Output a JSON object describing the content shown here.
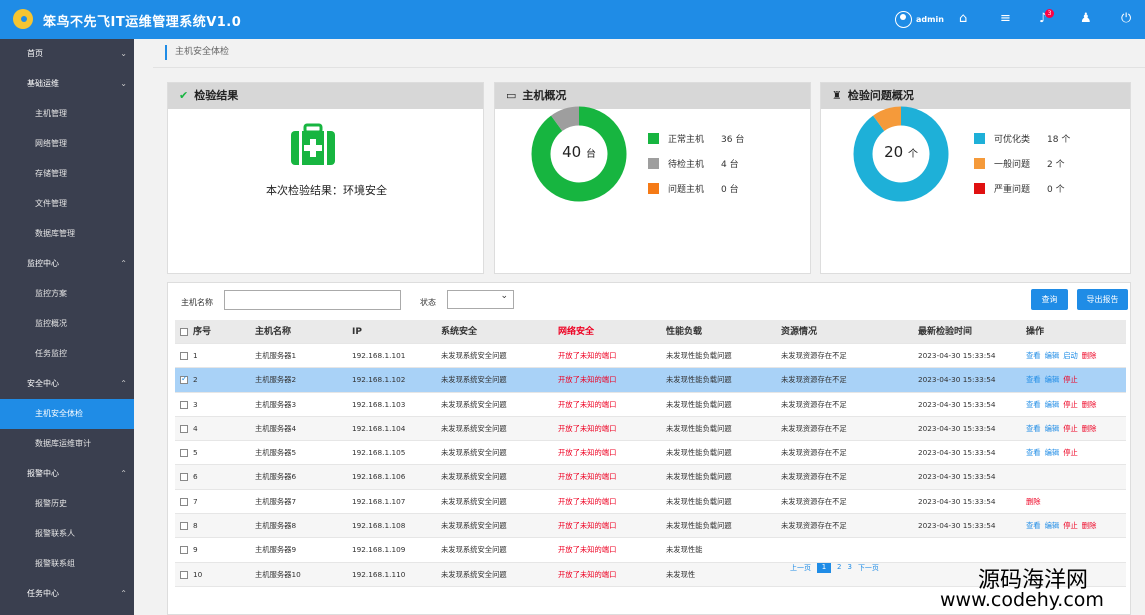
{
  "app": {
    "title": "笨鸟不先飞IT运维管理系统V1.0",
    "user": "admin",
    "notification_count": "3"
  },
  "sidebar": {
    "items": [
      {
        "label": "首页",
        "type": "group",
        "chev": "⌄"
      },
      {
        "label": "基础运维",
        "type": "group",
        "chev": "⌄"
      },
      {
        "label": "主机管理",
        "type": "child"
      },
      {
        "label": "网络管理",
        "type": "child"
      },
      {
        "label": "存储管理",
        "type": "child"
      },
      {
        "label": "文件管理",
        "type": "child"
      },
      {
        "label": "数据库管理",
        "type": "child"
      },
      {
        "label": "监控中心",
        "type": "group",
        "chev": "⌃"
      },
      {
        "label": "监控方案",
        "type": "child"
      },
      {
        "label": "监控概况",
        "type": "child"
      },
      {
        "label": "任务监控",
        "type": "child"
      },
      {
        "label": "安全中心",
        "type": "group",
        "chev": "⌃"
      },
      {
        "label": "主机安全体检",
        "type": "child",
        "active": true
      },
      {
        "label": "数据库运维审计",
        "type": "child"
      },
      {
        "label": "报警中心",
        "type": "group",
        "chev": "⌃"
      },
      {
        "label": "报警历史",
        "type": "child"
      },
      {
        "label": "报警联系人",
        "type": "child"
      },
      {
        "label": "报警联系组",
        "type": "child"
      },
      {
        "label": "任务中心",
        "type": "group",
        "chev": "⌃"
      }
    ]
  },
  "breadcrumb": "主机安全体检",
  "cards": {
    "result": {
      "title": "检验结果",
      "text": "本次检验结果：环境安全"
    },
    "hosts": {
      "title": "主机概况",
      "total": "40",
      "unit": "台",
      "legend": [
        {
          "label": "正常主机",
          "value": "36 台",
          "count": 36,
          "color": "#17b540"
        },
        {
          "label": "待检主机",
          "value": "4 台",
          "count": 4,
          "color": "#9e9e9e"
        },
        {
          "label": "问题主机",
          "value": "0 台",
          "count": 0,
          "color": "#f57a16"
        }
      ]
    },
    "issues": {
      "title": "检验问题概况",
      "total": "20",
      "unit": "个",
      "legend": [
        {
          "label": "可优化类",
          "value": "18 个",
          "count": 18,
          "color": "#1eb0d8"
        },
        {
          "label": "一般问题",
          "value": "2 个",
          "count": 2,
          "color": "#f59a3a"
        },
        {
          "label": "严重问题",
          "value": "0 个",
          "count": 0,
          "color": "#e01010"
        }
      ]
    }
  },
  "filters": {
    "host_label": "主机名称",
    "status_label": "状态",
    "query": "查询",
    "export": "导出报告"
  },
  "table": {
    "headers": [
      "序号",
      "主机名称",
      "IP",
      "系统安全",
      "网络安全",
      "性能负载",
      "资源情况",
      "最新检验时间",
      "操作"
    ],
    "rows": [
      {
        "no": "1",
        "name": "主机服务器1",
        "ip": "192.168.1.101",
        "sys": "未发现系统安全问题",
        "net": "开放了未知的端口",
        "perf": "未发现性能负载问题",
        "res": "未发现资源存在不足",
        "time": "2023-04-30 15:33:54",
        "ops": [
          "查看",
          "编辑",
          "启动",
          "删除"
        ]
      },
      {
        "no": "2",
        "name": "主机服务器2",
        "ip": "192.168.1.102",
        "sys": "未发现系统安全问题",
        "net": "开放了未知的端口",
        "perf": "未发现性能负载问题",
        "res": "未发现资源存在不足",
        "time": "2023-04-30 15:33:54",
        "ops": [
          "查看",
          "编辑",
          "停止"
        ],
        "selected": true
      },
      {
        "no": "3",
        "name": "主机服务器3",
        "ip": "192.168.1.103",
        "sys": "未发现系统安全问题",
        "net": "开放了未知的端口",
        "perf": "未发现性能负载问题",
        "res": "未发现资源存在不足",
        "time": "2023-04-30 15:33:54",
        "ops": [
          "查看",
          "编辑",
          "停止",
          "删除"
        ]
      },
      {
        "no": "4",
        "name": "主机服务器4",
        "ip": "192.168.1.104",
        "sys": "未发现系统安全问题",
        "net": "开放了未知的端口",
        "perf": "未发现性能负载问题",
        "res": "未发现资源存在不足",
        "time": "2023-04-30 15:33:54",
        "ops": [
          "查看",
          "编辑",
          "停止",
          "删除"
        ]
      },
      {
        "no": "5",
        "name": "主机服务器5",
        "ip": "192.168.1.105",
        "sys": "未发现系统安全问题",
        "net": "开放了未知的端口",
        "perf": "未发现性能负载问题",
        "res": "未发现资源存在不足",
        "time": "2023-04-30 15:33:54",
        "ops": [
          "查看",
          "编辑",
          "停止"
        ]
      },
      {
        "no": "6",
        "name": "主机服务器6",
        "ip": "192.168.1.106",
        "sys": "未发现系统安全问题",
        "net": "开放了未知的端口",
        "perf": "未发现性能负载问题",
        "res": "未发现资源存在不足",
        "time": "2023-04-30 15:33:54",
        "ops": []
      },
      {
        "no": "7",
        "name": "主机服务器7",
        "ip": "192.168.1.107",
        "sys": "未发现系统安全问题",
        "net": "开放了未知的端口",
        "perf": "未发现性能负载问题",
        "res": "未发现资源存在不足",
        "time": "2023-04-30 15:33:54",
        "ops": [
          "删除"
        ]
      },
      {
        "no": "8",
        "name": "主机服务器8",
        "ip": "192.168.1.108",
        "sys": "未发现系统安全问题",
        "net": "开放了未知的端口",
        "perf": "未发现性能负载问题",
        "res": "未发现资源存在不足",
        "time": "2023-04-30 15:33:54",
        "ops": [
          "查看",
          "编辑",
          "停止",
          "删除"
        ]
      },
      {
        "no": "9",
        "name": "主机服务器9",
        "ip": "192.168.1.109",
        "sys": "未发现系统安全问题",
        "net": "开放了未知的端口",
        "perf": "未发现性能",
        "res": "",
        "time": "",
        "ops": []
      },
      {
        "no": "10",
        "name": "主机服务器10",
        "ip": "192.168.1.110",
        "sys": "未发现系统安全问题",
        "net": "开放了未知的端口",
        "perf": "未发现性",
        "res": "",
        "time": "",
        "ops": []
      }
    ]
  },
  "pager": {
    "prev": "上一页",
    "pages": [
      "1",
      "2",
      "3"
    ],
    "next": "下一页"
  },
  "watermark": {
    "line1": "源码海洋网",
    "line2": "www.codehy.com"
  }
}
